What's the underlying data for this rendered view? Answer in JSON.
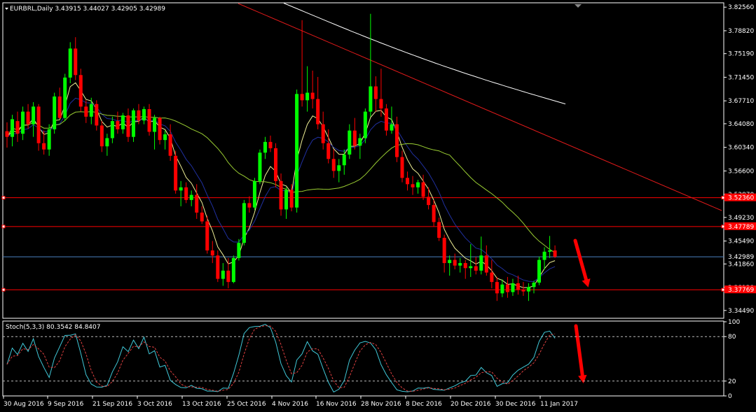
{
  "chart_data": {
    "type": "candlestick",
    "symbol_header": "EURBRL,Daily",
    "ohlc_header": [
      "3.43915",
      "3.44027",
      "3.42905",
      "3.42989"
    ],
    "price_axis": {
      "ylim": [
        3.3325,
        3.8325
      ],
      "ticks": [
        "3.82560",
        "3.78820",
        "3.75190",
        "3.71450",
        "3.67710",
        "3.64080",
        "3.60340",
        "3.56600",
        "3.52870",
        "3.49230",
        "3.45490",
        "3.41860",
        "3.38120",
        "3.34490"
      ]
    },
    "horizontal_lines": [
      {
        "label": "3.52360",
        "value": 3.5236,
        "color": "#ff0000"
      },
      {
        "label": "3.47789",
        "value": 3.4779,
        "color": "#ff0000"
      },
      {
        "label": "3.42989",
        "value": 3.4299,
        "color": "#4a7fc0"
      },
      {
        "label": "3.37769",
        "value": 3.3777,
        "color": "#ff0000"
      }
    ],
    "date_labels": [
      "30 Aug 2016",
      "9 Sep 2016",
      "21 Sep 2016",
      "3 Oct 2016",
      "13 Oct 2016",
      "25 Oct 2016",
      "4 Nov 2016",
      "16 Nov 2016",
      "28 Nov 2016",
      "8 Dec 2016",
      "20 Dec 2016",
      "30 Dec 2016",
      "11 Jan 2017"
    ],
    "candles": [
      [
        3.629,
        3.643,
        3.603,
        3.62
      ],
      [
        3.62,
        3.655,
        3.605,
        3.648
      ],
      [
        3.645,
        3.66,
        3.612,
        3.625
      ],
      [
        3.625,
        3.668,
        3.615,
        3.66
      ],
      [
        3.66,
        3.672,
        3.633,
        3.64
      ],
      [
        3.64,
        3.675,
        3.62,
        3.668
      ],
      [
        3.668,
        3.672,
        3.598,
        3.61
      ],
      [
        3.61,
        3.63,
        3.592,
        3.6
      ],
      [
        3.6,
        3.64,
        3.59,
        3.632
      ],
      [
        3.632,
        3.69,
        3.625,
        3.684
      ],
      [
        3.684,
        3.698,
        3.648,
        3.65
      ],
      [
        3.65,
        3.72,
        3.645,
        3.714
      ],
      [
        3.714,
        3.77,
        3.705,
        3.76
      ],
      [
        3.76,
        3.778,
        3.71,
        3.718
      ],
      [
        3.718,
        3.728,
        3.66,
        3.668
      ],
      [
        3.668,
        3.678,
        3.642,
        3.652
      ],
      [
        3.652,
        3.682,
        3.64,
        3.672
      ],
      [
        3.672,
        3.678,
        3.63,
        3.638
      ],
      [
        3.638,
        3.645,
        3.596,
        3.605
      ],
      [
        3.605,
        3.625,
        3.59,
        3.618
      ],
      [
        3.618,
        3.652,
        3.61,
        3.645
      ],
      [
        3.645,
        3.66,
        3.625,
        3.632
      ],
      [
        3.632,
        3.658,
        3.625,
        3.654
      ],
      [
        3.654,
        3.665,
        3.612,
        3.62
      ],
      [
        3.62,
        3.665,
        3.612,
        3.662
      ],
      [
        3.662,
        3.672,
        3.64,
        3.646
      ],
      [
        3.646,
        3.668,
        3.64,
        3.664
      ],
      [
        3.664,
        3.672,
        3.622,
        3.628
      ],
      [
        3.628,
        3.655,
        3.6,
        3.65
      ],
      [
        3.65,
        3.652,
        3.608,
        3.615
      ],
      [
        3.615,
        3.63,
        3.6,
        3.624
      ],
      [
        3.624,
        3.64,
        3.582,
        3.59
      ],
      [
        3.59,
        3.598,
        3.53,
        3.535
      ],
      [
        3.535,
        3.55,
        3.51,
        3.54
      ],
      [
        3.54,
        3.548,
        3.515,
        3.52
      ],
      [
        3.52,
        3.535,
        3.51,
        3.528
      ],
      [
        3.528,
        3.545,
        3.49,
        3.5
      ],
      [
        3.5,
        3.51,
        3.482,
        3.486
      ],
      [
        3.486,
        3.495,
        3.435,
        3.44
      ],
      [
        3.44,
        3.455,
        3.42,
        3.432
      ],
      [
        3.432,
        3.44,
        3.39,
        3.395
      ],
      [
        3.395,
        3.42,
        3.384,
        3.408
      ],
      [
        3.408,
        3.428,
        3.38,
        3.39
      ],
      [
        3.39,
        3.432,
        3.388,
        3.428
      ],
      [
        3.428,
        3.458,
        3.424,
        3.452
      ],
      [
        3.452,
        3.52,
        3.448,
        3.515
      ],
      [
        3.515,
        3.526,
        3.5,
        3.508
      ],
      [
        3.508,
        3.555,
        3.504,
        3.55
      ],
      [
        3.55,
        3.6,
        3.545,
        3.595
      ],
      [
        3.595,
        3.62,
        3.585,
        3.612
      ],
      [
        3.612,
        3.622,
        3.596,
        3.602
      ],
      [
        3.602,
        3.61,
        3.54,
        3.55
      ],
      [
        3.55,
        3.562,
        3.495,
        3.505
      ],
      [
        3.505,
        3.54,
        3.49,
        3.536
      ],
      [
        3.536,
        3.545,
        3.502,
        3.508
      ],
      [
        3.508,
        3.695,
        3.5,
        3.688
      ],
      [
        3.688,
        3.805,
        3.668,
        3.678
      ],
      [
        3.678,
        3.732,
        3.66,
        3.69
      ],
      [
        3.69,
        3.725,
        3.665,
        3.68
      ],
      [
        3.68,
        3.715,
        3.632,
        3.64
      ],
      [
        3.64,
        3.66,
        3.6,
        3.61
      ],
      [
        3.61,
        3.632,
        3.578,
        3.585
      ],
      [
        3.585,
        3.6,
        3.555,
        3.566
      ],
      [
        3.566,
        3.585,
        3.548,
        3.575
      ],
      [
        3.575,
        3.6,
        3.56,
        3.592
      ],
      [
        3.592,
        3.64,
        3.585,
        3.63
      ],
      [
        3.63,
        3.65,
        3.6,
        3.606
      ],
      [
        3.606,
        3.625,
        3.585,
        3.618
      ],
      [
        3.618,
        3.665,
        3.61,
        3.66
      ],
      [
        3.66,
        3.815,
        3.652,
        3.7
      ],
      [
        3.7,
        3.716,
        3.66,
        3.68
      ],
      [
        3.68,
        3.728,
        3.652,
        3.665
      ],
      [
        3.665,
        3.672,
        3.622,
        3.63
      ],
      [
        3.63,
        3.668,
        3.625,
        3.64
      ],
      [
        3.64,
        3.652,
        3.58,
        3.588
      ],
      [
        3.588,
        3.598,
        3.548,
        3.555
      ],
      [
        3.555,
        3.565,
        3.535,
        3.545
      ],
      [
        3.545,
        3.558,
        3.528,
        3.54
      ],
      [
        3.54,
        3.552,
        3.53,
        3.548
      ],
      [
        3.548,
        3.56,
        3.52,
        3.525
      ],
      [
        3.525,
        3.54,
        3.505,
        3.512
      ],
      [
        3.512,
        3.52,
        3.478,
        3.485
      ],
      [
        3.485,
        3.492,
        3.455,
        3.46
      ],
      [
        3.46,
        3.465,
        3.405,
        3.42
      ],
      [
        3.42,
        3.432,
        3.4,
        3.425
      ],
      [
        3.425,
        3.435,
        3.41,
        3.416
      ],
      [
        3.416,
        3.428,
        3.405,
        3.42
      ],
      [
        3.42,
        3.425,
        3.395,
        3.412
      ],
      [
        3.412,
        3.45,
        3.398,
        3.415
      ],
      [
        3.415,
        3.43,
        3.402,
        3.408
      ],
      [
        3.408,
        3.462,
        3.402,
        3.432
      ],
      [
        3.432,
        3.448,
        3.4,
        3.405
      ],
      [
        3.405,
        3.425,
        3.38,
        3.39
      ],
      [
        3.39,
        3.398,
        3.36,
        3.372
      ],
      [
        3.372,
        3.394,
        3.366,
        3.386
      ],
      [
        3.386,
        3.398,
        3.365,
        3.374
      ],
      [
        3.374,
        3.395,
        3.368,
        3.388
      ],
      [
        3.388,
        3.4,
        3.37,
        3.378
      ],
      [
        3.378,
        3.39,
        3.368,
        3.375
      ],
      [
        3.375,
        3.388,
        3.36,
        3.382
      ],
      [
        3.382,
        3.392,
        3.372,
        3.389
      ],
      [
        3.389,
        3.43,
        3.385,
        3.425
      ],
      [
        3.425,
        3.445,
        3.41,
        3.438
      ],
      [
        3.438,
        3.463,
        3.428,
        3.44
      ],
      [
        3.44,
        3.448,
        3.428,
        3.43
      ]
    ],
    "indicators": [
      {
        "type": "ema",
        "period": 5,
        "color": "#f0f096"
      },
      {
        "type": "ema",
        "period": 10,
        "color": "#2030a0"
      },
      {
        "type": "sma",
        "period": 30,
        "color": "#9acd32"
      },
      {
        "type": "sma",
        "period": 100,
        "color": "#ffffff"
      }
    ],
    "trendline": {
      "color": "#e21a1a",
      "from": [
        340,
        5
      ],
      "to": [
        1030,
        301
      ]
    },
    "stochastic": {
      "header": "Stoch(5,3,3) 80.3542 84.8407",
      "ticks": [
        "100",
        "80",
        "20",
        "0"
      ],
      "levels": [
        20,
        80
      ],
      "main_color": "#40c8d8",
      "signal_color": "#e04040"
    }
  }
}
